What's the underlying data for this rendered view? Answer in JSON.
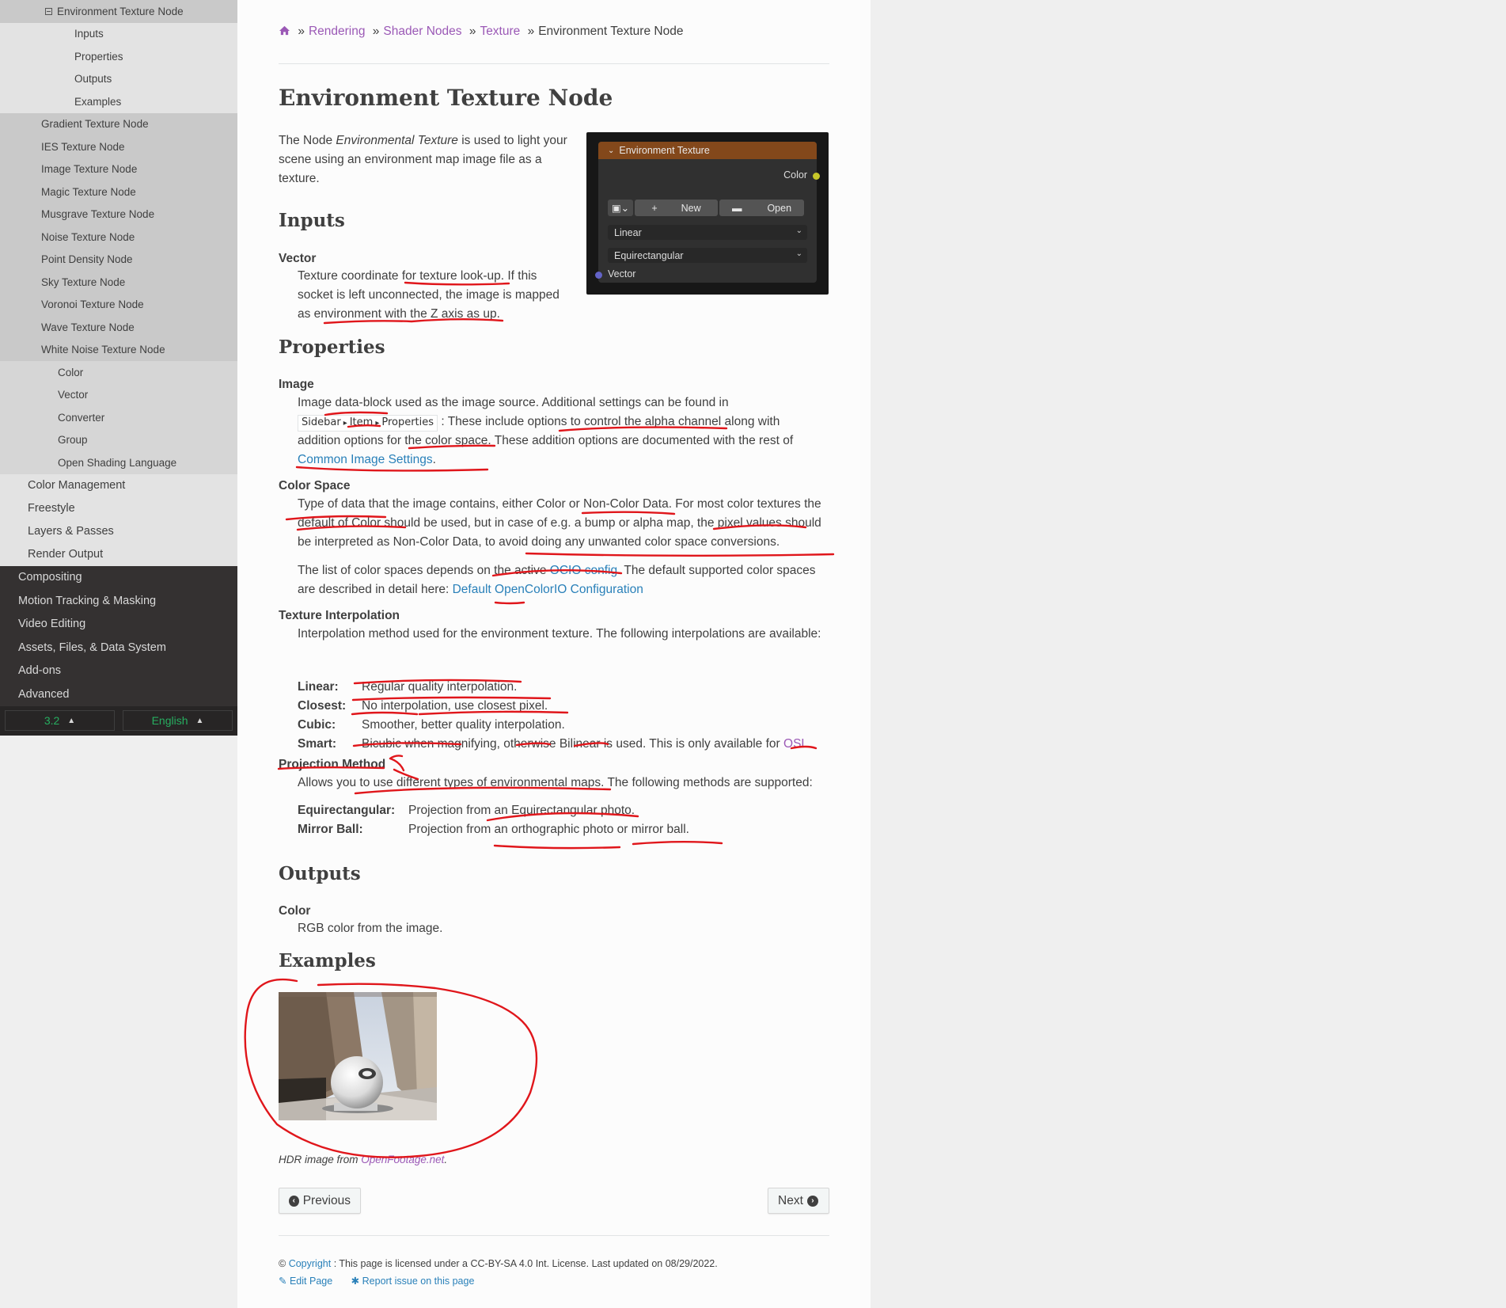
{
  "sidebar": {
    "items": [
      {
        "level": "l2",
        "label": "Environment Texture Node",
        "current": true
      },
      {
        "level": "l4",
        "label": "Inputs"
      },
      {
        "level": "l4",
        "label": "Properties"
      },
      {
        "level": "l4",
        "label": "Outputs"
      },
      {
        "level": "l4",
        "label": "Examples"
      },
      {
        "level": "l2",
        "label": "Gradient Texture Node"
      },
      {
        "level": "l2",
        "label": "IES Texture Node"
      },
      {
        "level": "l2",
        "label": "Image Texture Node"
      },
      {
        "level": "l2",
        "label": "Magic Texture Node"
      },
      {
        "level": "l2",
        "label": "Musgrave Texture Node"
      },
      {
        "level": "l2",
        "label": "Noise Texture Node"
      },
      {
        "level": "l2",
        "label": "Point Density Node"
      },
      {
        "level": "l2",
        "label": "Sky Texture Node"
      },
      {
        "level": "l2",
        "label": "Voronoi Texture Node"
      },
      {
        "level": "l2",
        "label": "Wave Texture Node"
      },
      {
        "level": "l2",
        "label": "White Noise Texture Node"
      },
      {
        "level": "l3",
        "label": "Color"
      },
      {
        "level": "l3",
        "label": "Vector"
      },
      {
        "level": "l3",
        "label": "Converter"
      },
      {
        "level": "l3",
        "label": "Group"
      },
      {
        "level": "l3",
        "label": "Open Shading Language"
      },
      {
        "level": "l1",
        "label": "Color Management"
      },
      {
        "level": "l1",
        "label": "Freestyle"
      },
      {
        "level": "l1",
        "label": "Layers & Passes"
      },
      {
        "level": "l1",
        "label": "Render Output"
      },
      {
        "level": "top",
        "label": "Compositing"
      },
      {
        "level": "top",
        "label": "Motion Tracking & Masking"
      },
      {
        "level": "top",
        "label": "Video Editing"
      },
      {
        "level": "top",
        "label": "Assets, Files, & Data System"
      },
      {
        "level": "top",
        "label": "Add-ons"
      },
      {
        "level": "top",
        "label": "Advanced"
      }
    ],
    "version": "3.2",
    "language": "English"
  },
  "breadcrumb": {
    "items": [
      "Rendering",
      "Shader Nodes",
      "Texture"
    ],
    "current": "Environment Texture Node",
    "separator": "»"
  },
  "page": {
    "title": "Environment Texture Node",
    "intro": {
      "before": "The Node ",
      "em": "Environmental Texture",
      "after": " is used to light your scene using an environment map image file as a texture."
    }
  },
  "node_image": {
    "title": "Environment Texture",
    "output_color": "Color",
    "new_label": "New",
    "open_label": "Open",
    "interpolation": "Linear",
    "projection": "Equirectangular",
    "input_vector": "Vector",
    "colors": {
      "header": "#83481b",
      "color_socket": "#c7c729",
      "vector_socket": "#6363c7"
    }
  },
  "inputs": {
    "heading": "Inputs",
    "vector_term": "Vector",
    "vector_desc": "Texture coordinate for texture look-up. If this socket is left unconnected, the image is mapped as environment with the Z axis as up."
  },
  "properties": {
    "heading": "Properties",
    "image_term": "Image",
    "image_desc_1": "Image data-block used as the image source. Additional settings can be found in",
    "menu_path": [
      "Sidebar",
      "Item",
      "Properties"
    ],
    "image_desc_2": ": These include options to control the alpha channel along with",
    "image_desc_3": "addition options for the color space. These addition options are documented with the rest of",
    "image_link": "Common Image Settings",
    "image_end": ".",
    "colorspace_term": "Color Space",
    "colorspace_desc": "Type of data that the image contains, either Color or Non-Color Data. For most color textures the default of Color should be used, but in case of e.g. a bump or alpha map, the pixel values should be interpreted as Non-Color Data, to avoid doing any unwanted color space conversions.",
    "colorspace_p2_before": "The list of color spaces depends on the active ",
    "colorspace_p2_link": "OCIO config",
    "colorspace_p2_mid": ". The default supported color spaces are described in detail here: ",
    "colorspace_p2_link2": "Default OpenColorIO Configuration",
    "interp_term": "Texture Interpolation",
    "interp_desc": "Interpolation method used for the environment texture. The following interpolations are available:",
    "interp_list": [
      {
        "k": "Linear:",
        "v": "Regular quality interpolation."
      },
      {
        "k": "Closest:",
        "v": "No interpolation, use closest pixel."
      },
      {
        "k": "Cubic:",
        "v": "Smoother, better quality interpolation."
      },
      {
        "k": "Smart:",
        "v": "Bicubic when magnifying, otherwise Bilinear is used. This is only available for "
      }
    ],
    "osl_link": "OSL",
    "osl_end": ".",
    "proj_term": "Projection Method",
    "proj_desc": "Allows you to use different types of environmental maps. The following methods are supported:",
    "proj_list": [
      {
        "k": "Equirectangular:",
        "v": "Projection from an Equirectangular photo."
      },
      {
        "k": "Mirror Ball:",
        "v": "Projection from an orthographic photo or mirror ball."
      }
    ]
  },
  "outputs": {
    "heading": "Outputs",
    "color_term": "Color",
    "color_desc": "RGB color from the image."
  },
  "examples": {
    "heading": "Examples",
    "caption_before": "HDR image from ",
    "caption_link": "OpenFootage.net",
    "caption_after": "."
  },
  "pager": {
    "previous": "Previous",
    "next": "Next"
  },
  "footer": {
    "copyright_symbol": "©",
    "copyright_link": "Copyright",
    "license": ": This page is licensed under a CC-BY-SA 4.0 Int. License. Last updated on 08/29/2022.",
    "edit": "Edit Page",
    "report": "Report issue on this page"
  }
}
